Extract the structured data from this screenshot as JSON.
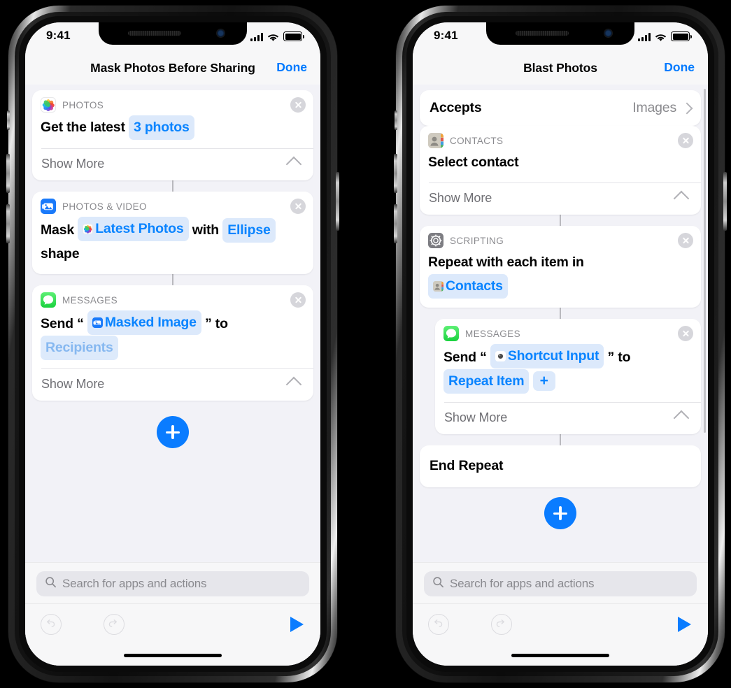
{
  "status_bar": {
    "time": "9:41",
    "wifi_icon": "wifi-icon",
    "cellular_icon": "cellular-bars-icon",
    "battery_icon": "battery-icon"
  },
  "phones": [
    {
      "id": "left",
      "nav": {
        "title": "Mask Photos Before Sharing",
        "done_label": "Done"
      },
      "accepts_row": null,
      "cards": [
        {
          "name": "photos-action",
          "category": "PHOTOS",
          "icon": "photos-app-icon",
          "close_icon": "close-circle-icon",
          "indent": false,
          "parts": [
            {
              "type": "text",
              "text": "Get the latest"
            },
            {
              "type": "token",
              "text": "3 photos",
              "icon": null,
              "dim": false
            }
          ],
          "show_more": "Show More",
          "chevron_icon": "chevron-up-icon"
        },
        {
          "name": "photos-video-action",
          "category": "PHOTOS & VIDEO",
          "icon": "photos-and-video-icon",
          "close_icon": "close-circle-icon",
          "indent": false,
          "parts": [
            {
              "type": "text",
              "text": "Mask"
            },
            {
              "type": "token",
              "text": "Latest Photos",
              "icon": "photos-app-icon",
              "dim": false
            },
            {
              "type": "text",
              "text": "with"
            },
            {
              "type": "token",
              "text": "Ellipse",
              "icon": null,
              "dim": false
            },
            {
              "type": "text",
              "text": "shape"
            }
          ],
          "show_more": null,
          "chevron_icon": null
        },
        {
          "name": "messages-action",
          "category": "MESSAGES",
          "icon": "messages-app-icon",
          "close_icon": "close-circle-icon",
          "indent": false,
          "parts": [
            {
              "type": "text",
              "text": "Send “"
            },
            {
              "type": "token",
              "text": "Masked Image",
              "icon": "photos-and-video-icon",
              "dim": false
            },
            {
              "type": "text",
              "text": "” to"
            },
            {
              "type": "token",
              "text": "Recipients",
              "icon": null,
              "dim": true
            }
          ],
          "show_more": "Show More",
          "chevron_icon": "chevron-up-icon"
        }
      ],
      "add_button_icon": "add-action-plus-button",
      "add_button_clipped": false,
      "search": {
        "placeholder": "Search for apps and actions",
        "icon": "search-icon"
      },
      "toolbar": {
        "undo_icon": "undo-icon",
        "redo_icon": "redo-icon",
        "play_icon": "play-run-icon"
      }
    },
    {
      "id": "right",
      "nav": {
        "title": "Blast Photos",
        "done_label": "Done"
      },
      "accepts_row": {
        "label": "Accepts",
        "value": "Images",
        "chevron_icon": "chevron-right-icon"
      },
      "cards": [
        {
          "name": "contacts-action",
          "category": "CONTACTS",
          "icon": "contacts-app-icon",
          "close_icon": "close-circle-icon",
          "indent": false,
          "parts": [
            {
              "type": "text",
              "text": "Select contact"
            }
          ],
          "show_more": "Show More",
          "chevron_icon": "chevron-up-icon"
        },
        {
          "name": "scripting-repeat-action",
          "category": "SCRIPTING",
          "icon": "scripting-gear-icon",
          "close_icon": "close-circle-icon",
          "indent": false,
          "parts": [
            {
              "type": "text",
              "text": "Repeat with each item in"
            },
            {
              "type": "break"
            },
            {
              "type": "token",
              "text": "Contacts",
              "icon": "contacts-app-icon",
              "dim": false
            }
          ],
          "show_more": null,
          "chevron_icon": null
        },
        {
          "name": "messages-action",
          "category": "MESSAGES",
          "icon": "messages-app-icon",
          "close_icon": "close-circle-icon",
          "indent": true,
          "parts": [
            {
              "type": "text",
              "text": "Send “"
            },
            {
              "type": "token",
              "text": "Shortcut Input",
              "icon": "shortcut-input-dot-icon",
              "dim": false
            },
            {
              "type": "text",
              "text": "” to"
            },
            {
              "type": "token",
              "text": "Repeat Item",
              "icon": null,
              "dim": false
            },
            {
              "type": "token",
              "text": "+",
              "icon": null,
              "dim": false,
              "plus": true
            }
          ],
          "show_more": "Show More",
          "chevron_icon": "chevron-up-icon"
        },
        {
          "name": "end-repeat-action",
          "category": null,
          "icon": null,
          "close_icon": null,
          "indent": false,
          "plain": true,
          "parts": [
            {
              "type": "text",
              "text": "End Repeat"
            }
          ],
          "show_more": null,
          "chevron_icon": null
        }
      ],
      "add_button_icon": "add-action-plus-button",
      "add_button_clipped": true,
      "search": {
        "placeholder": "Search for apps and actions",
        "icon": "search-icon"
      },
      "toolbar": {
        "undo_icon": "undo-icon",
        "redo_icon": "redo-icon",
        "play_icon": "play-run-icon"
      }
    }
  ],
  "colors": {
    "accent_blue": "#0a7cff",
    "token_blue_text": "#0a84ff",
    "token_bg": "#dce9fb",
    "screen_bg": "#f2f2f7",
    "card_bg": "#ffffff",
    "category_gray": "#8a8a8e"
  }
}
